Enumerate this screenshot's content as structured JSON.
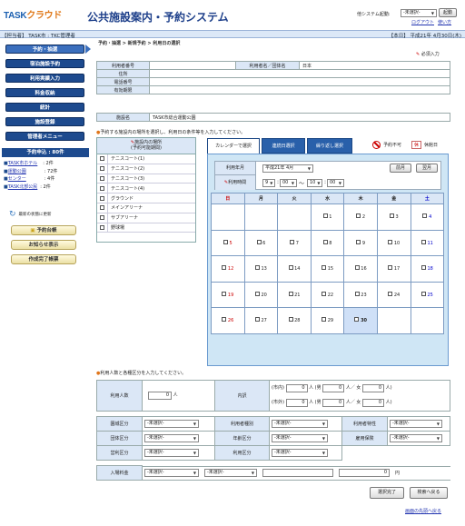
{
  "header": {
    "logo_main": "TASK",
    "logo_accent": "クラウド",
    "title": "公共施設案内・予約システム",
    "other_system_label": "他システム起動:",
    "other_system_select": "-未選択-",
    "launch_button": "起動",
    "logout": "ログアウト",
    "help": "使い方"
  },
  "statusbar": {
    "user": "【担当者】 TASK市 : TKC管理者",
    "date": "【本日】 平成21年 4月30日(木)"
  },
  "sidebar": {
    "nav": [
      "予約・抽選",
      "宿泊施設予約",
      "利用実績入力",
      "料金収納",
      "統計",
      "施設登録",
      "管理者メニュー"
    ],
    "request_header": "予約申込 : 80件",
    "requests": [
      {
        "name": "TASK市ホテル",
        "count": ": 2件"
      },
      {
        "name": "運動公園",
        "count": ": 72件"
      },
      {
        "name": "センター",
        "count": ": 4件"
      },
      {
        "name": "TASK北部公民",
        "count": ": 2件"
      }
    ],
    "refresh": "最新の状態に更新",
    "buttons": [
      "予約台帳",
      "お知らせ表示",
      "作成完了帳票"
    ]
  },
  "breadcrumb": "予約・抽選 > 新規予約 > 利用日の選択",
  "required_note": "必須入力",
  "info": {
    "user_no_label": "利用者番号",
    "user_name_label": "利用者名／団体名",
    "user_name_value": "日本",
    "address_label": "住所",
    "phone_label": "電話番号",
    "expiry_label": "有効期限",
    "facility_label": "施設名",
    "facility_value": "TASK市総合運動公園"
  },
  "note1": "予約する施設内の場所を選択し、利用日の条件等を入力してください。",
  "facility_list": {
    "header1": "施設内の場所",
    "header2": "(予約可能期間)",
    "items": [
      "テニスコート(1)",
      "テニスコート(2)",
      "テニスコート(3)",
      "テニスコート(4)",
      "グラウンド",
      "メインアリーナ",
      "サブアリーナ",
      "野球場"
    ]
  },
  "tabs": [
    "カレンダーで選択",
    "連続日選択",
    "繰り返し選択"
  ],
  "legend": {
    "unavailable": "予約不可",
    "holiday_badge": "休",
    "holiday": "休館日"
  },
  "calendar": {
    "month_label": "利用年月",
    "month_value": "平成21年 4月",
    "prev": "前月",
    "next": "翌月",
    "time_label": "利用時間",
    "time_from_h": "9",
    "time_from_m": "00",
    "time_sep": "～",
    "time_to_h": "10",
    "time_to_m": "00",
    "weekdays": [
      "日",
      "月",
      "火",
      "水",
      "木",
      "金",
      "土"
    ],
    "weeks": [
      [
        "",
        "",
        "",
        "1",
        "2",
        "3",
        "4"
      ],
      [
        "5",
        "6",
        "7",
        "8",
        "9",
        "10",
        "11"
      ],
      [
        "12",
        "13",
        "14",
        "15",
        "16",
        "17",
        "18"
      ],
      [
        "19",
        "20",
        "21",
        "22",
        "23",
        "24",
        "25"
      ],
      [
        "26",
        "27",
        "28",
        "29",
        "30",
        "",
        ""
      ]
    ]
  },
  "note2": "利用人数と各種区分を入力してください。",
  "people": {
    "count_label": "利用人数",
    "count_value": "0",
    "unit": "人",
    "breakdown_label": "内訳",
    "in_city": "(市内)",
    "out_city": "(市外)",
    "male": "人 (男",
    "female": "人／ 女",
    "end": "人)",
    "vals": "0"
  },
  "categories": {
    "reduction": "園城区分",
    "user_type": "利用者種別",
    "user_trait": "利用者特性",
    "group": "団体区分",
    "age": "年齢区分",
    "employment": "雇用保険",
    "commercial": "営利区分",
    "purpose": "利用区分",
    "unselected": "-未選択-"
  },
  "fee": {
    "label": "入場料金",
    "value": "0",
    "unit": "円"
  },
  "actions": {
    "done": "選択完了",
    "back": "検索へ戻る"
  },
  "page_top": "画面の先頭へ戻る",
  "colors": {
    "nav": "#1d4a8e",
    "header_bg": "#dbe7f6",
    "panel": "#cfe6f5"
  }
}
